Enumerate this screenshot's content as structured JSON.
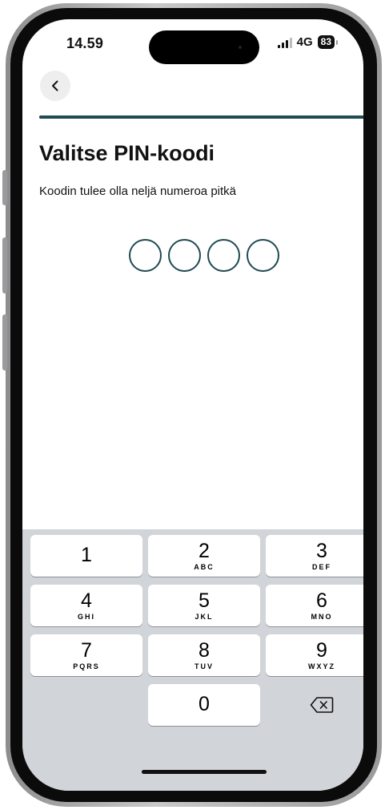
{
  "status_bar": {
    "time": "14.59",
    "network": "4G",
    "battery": "83",
    "icons": [
      "signal-icon",
      "battery-icon"
    ]
  },
  "header": {
    "back_icon": "chevron-left-icon",
    "progress_percent": 100
  },
  "main": {
    "title": "Valitse PIN-koodi",
    "subtitle": "Koodin tulee olla neljä numeroa pitkä",
    "pin_length": 4,
    "pin_entered": 0
  },
  "keypad": {
    "keys": [
      {
        "digit": "1",
        "letters": ""
      },
      {
        "digit": "2",
        "letters": "ABC"
      },
      {
        "digit": "3",
        "letters": "DEF"
      },
      {
        "digit": "4",
        "letters": "GHI"
      },
      {
        "digit": "5",
        "letters": "JKL"
      },
      {
        "digit": "6",
        "letters": "MNO"
      },
      {
        "digit": "7",
        "letters": "PQRS"
      },
      {
        "digit": "8",
        "letters": "TUV"
      },
      {
        "digit": "9",
        "letters": "WXYZ"
      },
      {
        "digit": "0",
        "letters": ""
      }
    ],
    "delete_icon": "backspace-icon"
  },
  "colors": {
    "accent": "#1f4b52",
    "keyboard_bg": "#d1d4d9",
    "key_bg": "#ffffff"
  }
}
